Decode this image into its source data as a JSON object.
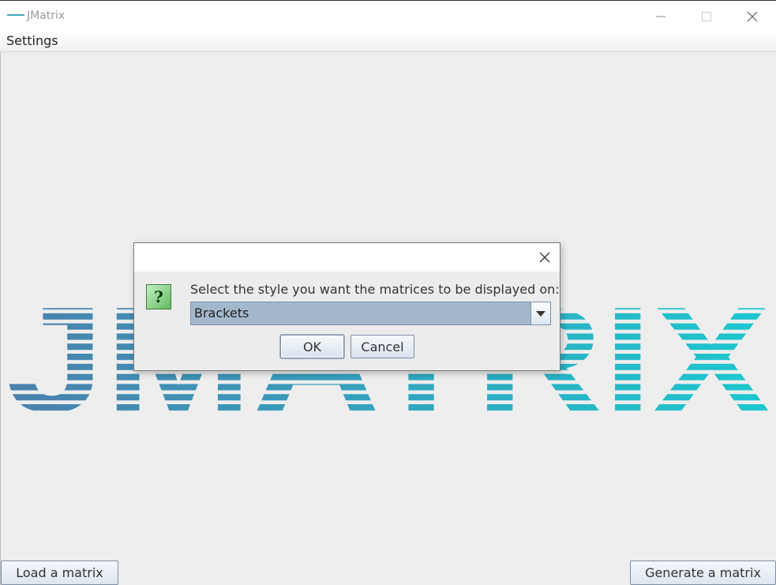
{
  "window": {
    "title": "JMatrix",
    "icon_text": "JMATRIX",
    "controls": [
      "minimize-icon",
      "maximize-icon",
      "close-icon"
    ]
  },
  "menubar": {
    "settings_label": "Settings"
  },
  "background_logo": {
    "text": "JMATRIX",
    "color_start": "#4a80ad",
    "color_end": "#1cc8cf"
  },
  "buttons": {
    "load_label": "Load a matrix",
    "generate_label": "Generate a matrix"
  },
  "dialog": {
    "icon": "question-icon",
    "question_glyph": "?",
    "message": "Select the style you want the matrices to be displayed on:",
    "combo_value": "Brackets",
    "ok_label": "OK",
    "cancel_label": "Cancel"
  }
}
